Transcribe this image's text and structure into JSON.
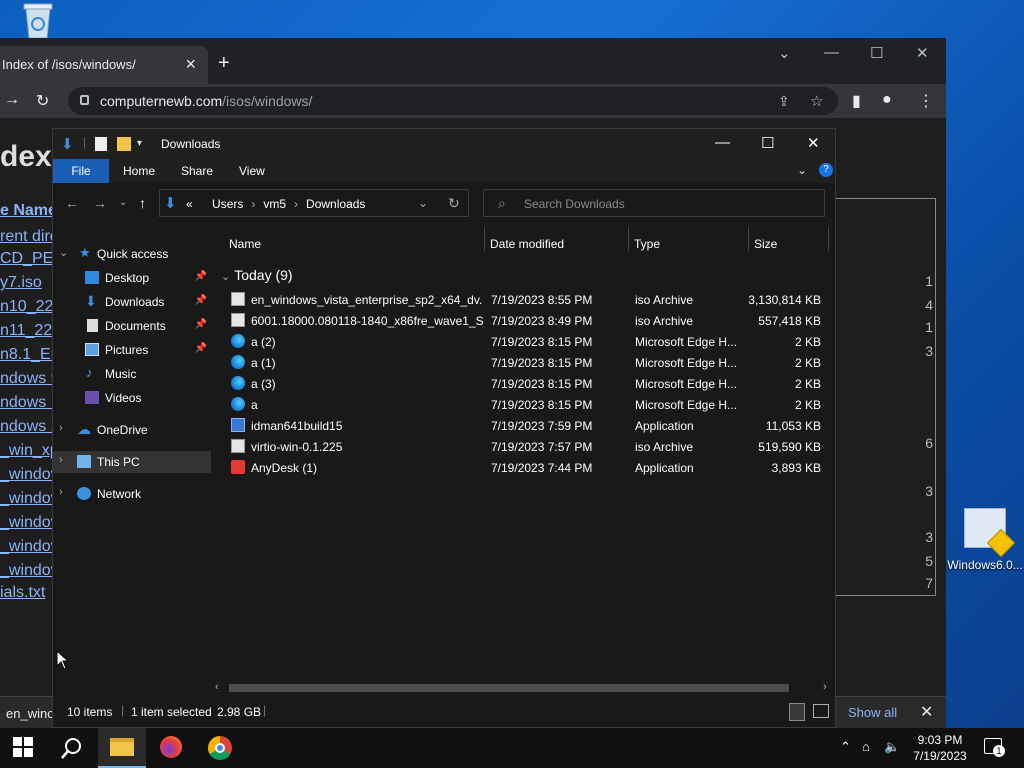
{
  "desktop": {
    "icons": [
      {
        "label": "Windows6.0..."
      }
    ]
  },
  "browser": {
    "tab_title": "Index of /isos/windows/",
    "new_tab_symbol": "+",
    "url_host": "computernewb.com",
    "url_path": "/isos/windows/",
    "page": {
      "heading": "dex",
      "header_link": "e Name",
      "links": [
        "rent dire",
        "CD_PE",
        "y7.iso",
        "n10_22I",
        "n11_22I",
        "n8.1_Er",
        "ndows 9",
        "ndows M",
        "ndows X",
        "_win_xp",
        "_windov",
        "_windov",
        "_windov",
        "_windov",
        "_windov",
        "ials.txt"
      ],
      "right_digits": [
        "1",
        "4",
        "1",
        "3",
        "6",
        "3",
        "3",
        "5",
        "7"
      ]
    },
    "download_bar": {
      "file": "en_winc",
      "show_all": "Show all"
    }
  },
  "explorer": {
    "title": "Downloads",
    "ribbon_tabs": [
      "File",
      "Home",
      "Share",
      "View"
    ],
    "breadcrumb": [
      "Users",
      "vm5",
      "Downloads"
    ],
    "breadcrumb_prefix": "«",
    "search_placeholder": "Search Downloads",
    "nav": {
      "quick_access": "Quick access",
      "items": [
        "Desktop",
        "Downloads",
        "Documents",
        "Pictures",
        "Music",
        "Videos"
      ],
      "onedrive": "OneDrive",
      "this_pc": "This PC",
      "network": "Network"
    },
    "columns": [
      "Name",
      "Date modified",
      "Type",
      "Size"
    ],
    "group": "Today (9)",
    "files": [
      {
        "name": "en_windows_vista_enterprise_sp2_x64_dv...",
        "date": "7/19/2023 8:55 PM",
        "type": "iso Archive",
        "size": "3,130,814 KB",
        "icon": "iso-archive-icon"
      },
      {
        "name": "6001.18000.080118-1840_x86fre_wave1_Se...",
        "date": "7/19/2023 8:49 PM",
        "type": "iso Archive",
        "size": "557,418 KB",
        "icon": "iso-archive-icon"
      },
      {
        "name": "a (2)",
        "date": "7/19/2023 8:15 PM",
        "type": "Microsoft Edge H...",
        "size": "2 KB",
        "icon": "edge-html-icon"
      },
      {
        "name": "a (1)",
        "date": "7/19/2023 8:15 PM",
        "type": "Microsoft Edge H...",
        "size": "2 KB",
        "icon": "edge-html-icon"
      },
      {
        "name": "a (3)",
        "date": "7/19/2023 8:15 PM",
        "type": "Microsoft Edge H...",
        "size": "2 KB",
        "icon": "edge-html-icon"
      },
      {
        "name": "a",
        "date": "7/19/2023 8:15 PM",
        "type": "Microsoft Edge H...",
        "size": "2 KB",
        "icon": "edge-html-icon"
      },
      {
        "name": "idman641build15",
        "date": "7/19/2023 7:59 PM",
        "type": "Application",
        "size": "11,053 KB",
        "icon": "application-icon"
      },
      {
        "name": "virtio-win-0.1.225",
        "date": "7/19/2023 7:57 PM",
        "type": "iso Archive",
        "size": "519,590 KB",
        "icon": "iso-archive-icon"
      },
      {
        "name": "AnyDesk (1)",
        "date": "7/19/2023 7:44 PM",
        "type": "Application",
        "size": "3,893 KB",
        "icon": "anydesk-icon"
      }
    ],
    "status": {
      "items": "10 items",
      "selected": "1 item selected",
      "size": "2.98 GB"
    }
  },
  "taskbar": {
    "time": "9:03 PM",
    "date": "7/19/2023",
    "notification_count": "1"
  },
  "colors": {
    "accent": "#1a5fb4",
    "link": "#8ab4f8",
    "explorer_bg": "#191919",
    "taskbar_bg": "#101010"
  }
}
